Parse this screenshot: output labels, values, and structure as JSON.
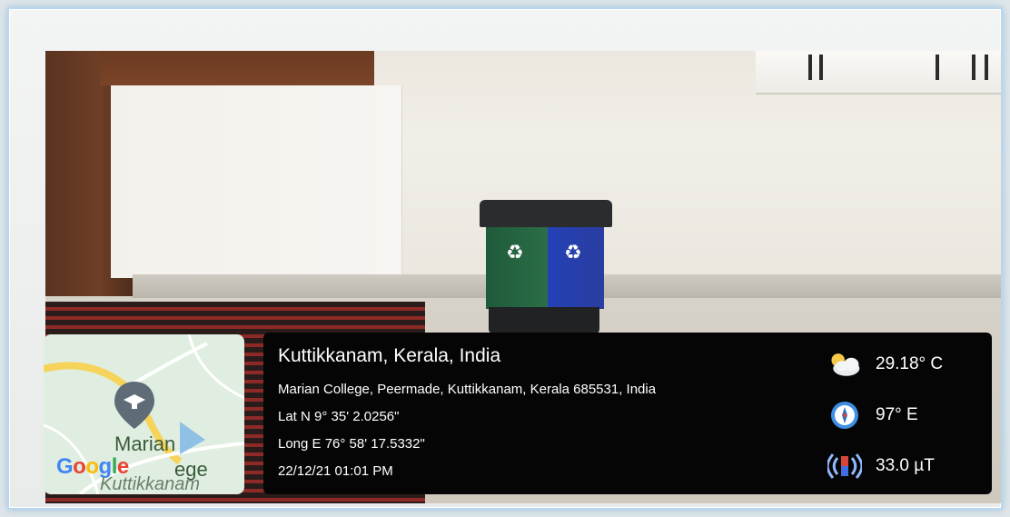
{
  "location": {
    "place": "Kuttikkanam, Kerala, India",
    "address": "Marian College, Peermade, Kuttikkanam, Kerala 685531, India",
    "latitude": "Lat N 9° 35' 2.0256\"",
    "longitude": "Long E 76° 58' 17.5332\"",
    "datetime": "22/12/21 01:01 PM"
  },
  "metrics": {
    "temperature": "29.18° C",
    "direction": "97° E",
    "magnetic": "33.0 µT"
  },
  "map": {
    "label_top": "Marian",
    "label_mid": "ege",
    "label_bottom": "Kuttikkanam",
    "logo": [
      "G",
      "o",
      "o",
      "g",
      "l",
      "e"
    ]
  },
  "icons": {
    "weather": "partly-cloudy-icon",
    "compass": "compass-icon",
    "magnet": "magnetic-field-icon",
    "map_pin": "graduation-cap-pin-icon",
    "recycle": "recycle-icon"
  },
  "colors": {
    "panel_bg": "#050505",
    "bin_green": "#2b6e47",
    "bin_blue": "#2a3ea0",
    "frame_border": "#b8d7ee"
  }
}
